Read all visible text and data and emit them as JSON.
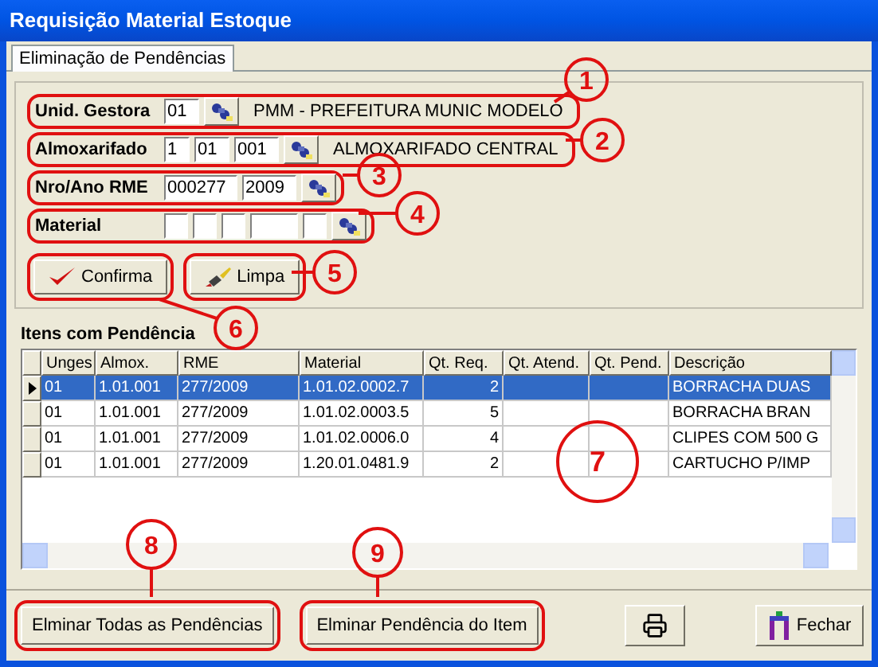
{
  "window": {
    "title": "Requisição Material Estoque"
  },
  "tabs": [
    {
      "label": "Eliminação de Pendências",
      "selected": true
    }
  ],
  "fields": [
    {
      "label": "Unid. Gestora",
      "inputs": [
        {
          "value": "01"
        }
      ],
      "description": "PMM - PREFEITURA MUNIC MODELO"
    },
    {
      "label": "Almoxarifado",
      "inputs": [
        {
          "value": "1"
        },
        {
          "value": "01"
        },
        {
          "value": "001"
        }
      ],
      "description": "ALMOXARIFADO CENTRAL"
    },
    {
      "label": "Nro/Ano RME",
      "inputs": [
        {
          "value": "000277"
        },
        {
          "value": "2009"
        }
      ]
    },
    {
      "label": "Material",
      "inputs": [
        {
          "kind": "short"
        },
        {
          "kind": "short"
        },
        {
          "kind": "short"
        },
        {
          "kind": "long"
        },
        {
          "kind": "short"
        }
      ]
    }
  ],
  "actions": [
    {
      "label": "Confirma",
      "kind": "check"
    },
    {
      "label": "Limpa",
      "kind": "brush"
    }
  ],
  "grid": {
    "title": "Itens com Pendência",
    "columns": [
      "Unges",
      "Almox.",
      "RME",
      "Material",
      "Qt. Req.",
      "Qt. Atend.",
      "Qt. Pend.",
      "Descrição"
    ],
    "rows": [
      {
        "selected": true,
        "cells": [
          "01",
          "1.01.001",
          "277/2009",
          "1.01.02.0002.7",
          "2",
          "",
          "",
          "BORRACHA DUAS"
        ]
      },
      {
        "selected": false,
        "cells": [
          "01",
          "1.01.001",
          "277/2009",
          "1.01.02.0003.5",
          "5",
          "",
          "",
          "BORRACHA BRAN"
        ]
      },
      {
        "selected": false,
        "cells": [
          "01",
          "1.01.001",
          "277/2009",
          "1.01.02.0006.0",
          "4",
          "",
          "",
          "CLIPES COM 500 G"
        ]
      },
      {
        "selected": false,
        "cells": [
          "01",
          "1.01.001",
          "277/2009",
          "1.20.01.0481.9",
          "2",
          "",
          "",
          "CARTUCHO P/IMP"
        ]
      }
    ]
  },
  "bottom_buttons": [
    {
      "kind": "text",
      "label": "Elminar Todas as Pendências"
    },
    {
      "kind": "text",
      "label": "Elminar Pendência do Item"
    },
    {
      "kind": "print"
    },
    {
      "kind": "close",
      "label": "Fechar"
    }
  ],
  "callouts": [
    "1",
    "2",
    "3",
    "4",
    "5",
    "6",
    "7",
    "8",
    "9"
  ]
}
